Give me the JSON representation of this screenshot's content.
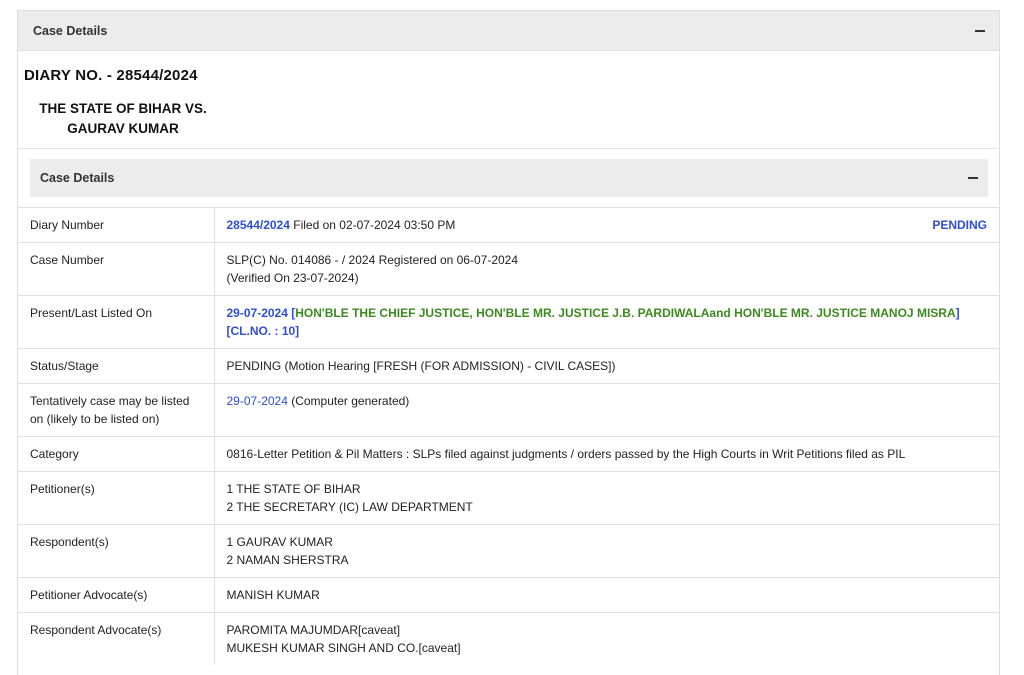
{
  "outer_panel": {
    "title": "Case Details"
  },
  "diary_title": "DIARY NO. - 28544/2024",
  "parties": {
    "line1": "THE STATE OF BIHAR VS.",
    "line2": "GAURAV KUMAR"
  },
  "inner_panel": {
    "title": "Case Details"
  },
  "rows": {
    "diary": {
      "label": "Diary Number",
      "number": "28544/2024",
      "filed": " Filed on 02-07-2024 03:50 PM",
      "status": "PENDING"
    },
    "case_number": {
      "label": "Case Number",
      "line1": "SLP(C) No. 014086 - / 2024 Registered on 06-07-2024",
      "line2": "(Verified On 23-07-2024)"
    },
    "listed": {
      "label": "Present/Last Listed On",
      "date": "29-07-2024",
      "open_bracket": " [",
      "bench": "HON'BLE THE CHIEF JUSTICE, HON'BLE MR. JUSTICE J.B. PARDIWALAand HON'BLE MR. JUSTICE MANOJ MISRA",
      "close": "]",
      "clno": "[CL.NO. : 10]"
    },
    "status": {
      "label": "Status/Stage",
      "value": "PENDING (Motion Hearing [FRESH (FOR ADMISSION) - CIVIL CASES])"
    },
    "tentative": {
      "label": "Tentatively case may be listed on (likely to be listed on)",
      "date": "29-07-2024",
      "note": " (Computer generated)"
    },
    "category": {
      "label": "Category",
      "value": "0816-Letter Petition & Pil Matters : SLPs filed against judgments / orders passed by the High Courts in Writ Petitions filed as PIL"
    },
    "petitioners": {
      "label": "Petitioner(s)",
      "line1": "1 THE STATE OF BIHAR",
      "line2": "2 THE SECRETARY (IC) LAW DEPARTMENT"
    },
    "respondents": {
      "label": "Respondent(s)",
      "line1": "1 GAURAV KUMAR",
      "line2": "2 NAMAN SHERSTRA"
    },
    "pet_adv": {
      "label": "Petitioner Advocate(s)",
      "value": "MANISH KUMAR"
    },
    "resp_adv": {
      "label": "Respondent Advocate(s)",
      "line1": "PAROMITA MAJUMDAR[caveat]",
      "line2": "MUKESH KUMAR SINGH AND CO.[caveat]"
    }
  },
  "colors": {
    "link_blue": "#2f4ed6",
    "bench_green": "#3c8a1f",
    "status_red": "#e0463a",
    "header_gray": "#ececec"
  }
}
